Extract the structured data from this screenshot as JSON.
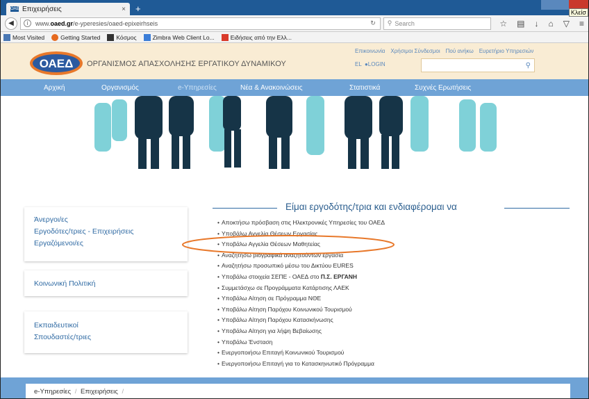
{
  "browser": {
    "tab_title": "Επιχειρήσεις",
    "tab_favicon": "ΟΑΕΔ",
    "tab_close": "×",
    "new_tab": "+",
    "tooltip": "Κλείσ",
    "url_prefix": "www.",
    "url_domain": "oaed.gr",
    "url_path": "/e-yperesies/oaed-epixeirhseis",
    "search_placeholder": "Search",
    "bookmarks": [
      {
        "label": "Most Visited",
        "color": "#4a78b5"
      },
      {
        "label": "Getting Started",
        "color": "#e66a1f"
      },
      {
        "label": "Κόσμος",
        "color": "#333333"
      },
      {
        "label": "Zimbra Web Client Lo...",
        "color": "#3b7dd8"
      },
      {
        "label": "Ειδήσεις από την Ελλ...",
        "color": "#d93a2b"
      }
    ]
  },
  "site": {
    "logo_text": "ΟΑΕΔ",
    "org_name": "ΟΡΓΑΝΙΣΜΟΣ ΑΠΑΣΧΟΛΗΣΗΣ ΕΡΓΑΤΙΚΟΥ ΔΥΝΑΜΙΚΟΥ",
    "top_links": [
      "Επικοινωνία",
      "Χρήσιμοι Σύνδεσμοι",
      "Πού ανήκω",
      "Ευρετήριο Υπηρεσιών"
    ],
    "lang": "EL",
    "login": "LOGIN",
    "nav": [
      "Αρχική",
      "Οργανισμός",
      "e-Υπηρεσίες",
      "Νέα & Ανακοινώσεις",
      "Στατιστικά",
      "Συχνές Ερωτήσεις"
    ],
    "active_nav": "e-Υπηρεσίες"
  },
  "sidebar": {
    "group1": [
      "Άνεργοι/ες",
      "Εργοδότες/τριες - Επιχειρήσεις",
      "Εργαζόμενοι/ες"
    ],
    "group2": [
      "Κοινωνική Πολιτική"
    ],
    "group3": [
      "Εκπαιδευτικοί",
      "Σπουδαστές/τριες"
    ]
  },
  "main": {
    "heading": "Είμαι εργοδότης/τρια και ενδιαφέρομαι να",
    "options": [
      "Αποκτήσω πρόσβαση στις Ηλεκτρονικές Υπηρεσίες του ΟΑΕΔ",
      "Υποβάλω Αγγελία Θέσεων Εργασίας",
      "Υποβάλω Αγγελία Θέσεων Μαθητείας",
      "Αναζητήσω βιογραφικά αναζητούντων εργασία",
      "Αναζητήσω προσωπικό μέσω του Δικτύου EURES",
      "Υποβάλω στοιχεία ΣΕΠΕ - ΟΑΕΔ στο ",
      "Συμμετάσχω σε Προγράμματα Κατάρτισης ΛΑΕΚ",
      "Υποβάλω Αίτηση σε Πρόγραμμα ΝΘΕ",
      "Υποβάλω Αίτηση Παρόχου Κοινωνικού Τουρισμού",
      "Υποβάλω Αίτηση Παρόχου Κατασκήνωσης",
      "Υποβάλω Αίτηση για λήψη Βεβαίωσης",
      "Υποβάλω  Ένσταση",
      "Ενεργοποιήσω Επιταγή Κοινωνικού Τουρισμού",
      "Ενεργοποιήσω Επιταγή για το Κατασκηνωτικό Πρόγραμμα"
    ],
    "ergani_bold": "Π.Σ. ΕΡΓΑΝΗ",
    "highlighted_option": "Υποβάλω Αγγελία Θέσεων Μαθητείας"
  },
  "breadcrumb": {
    "items": [
      "e-Υπηρεσίες",
      "Επιχειρήσεις"
    ],
    "sep": "/"
  },
  "colors": {
    "nav_bg": "#6fa3d6",
    "header_bg": "#f9ecd4",
    "link": "#2f6aa3",
    "annotation": "#e8782a"
  }
}
